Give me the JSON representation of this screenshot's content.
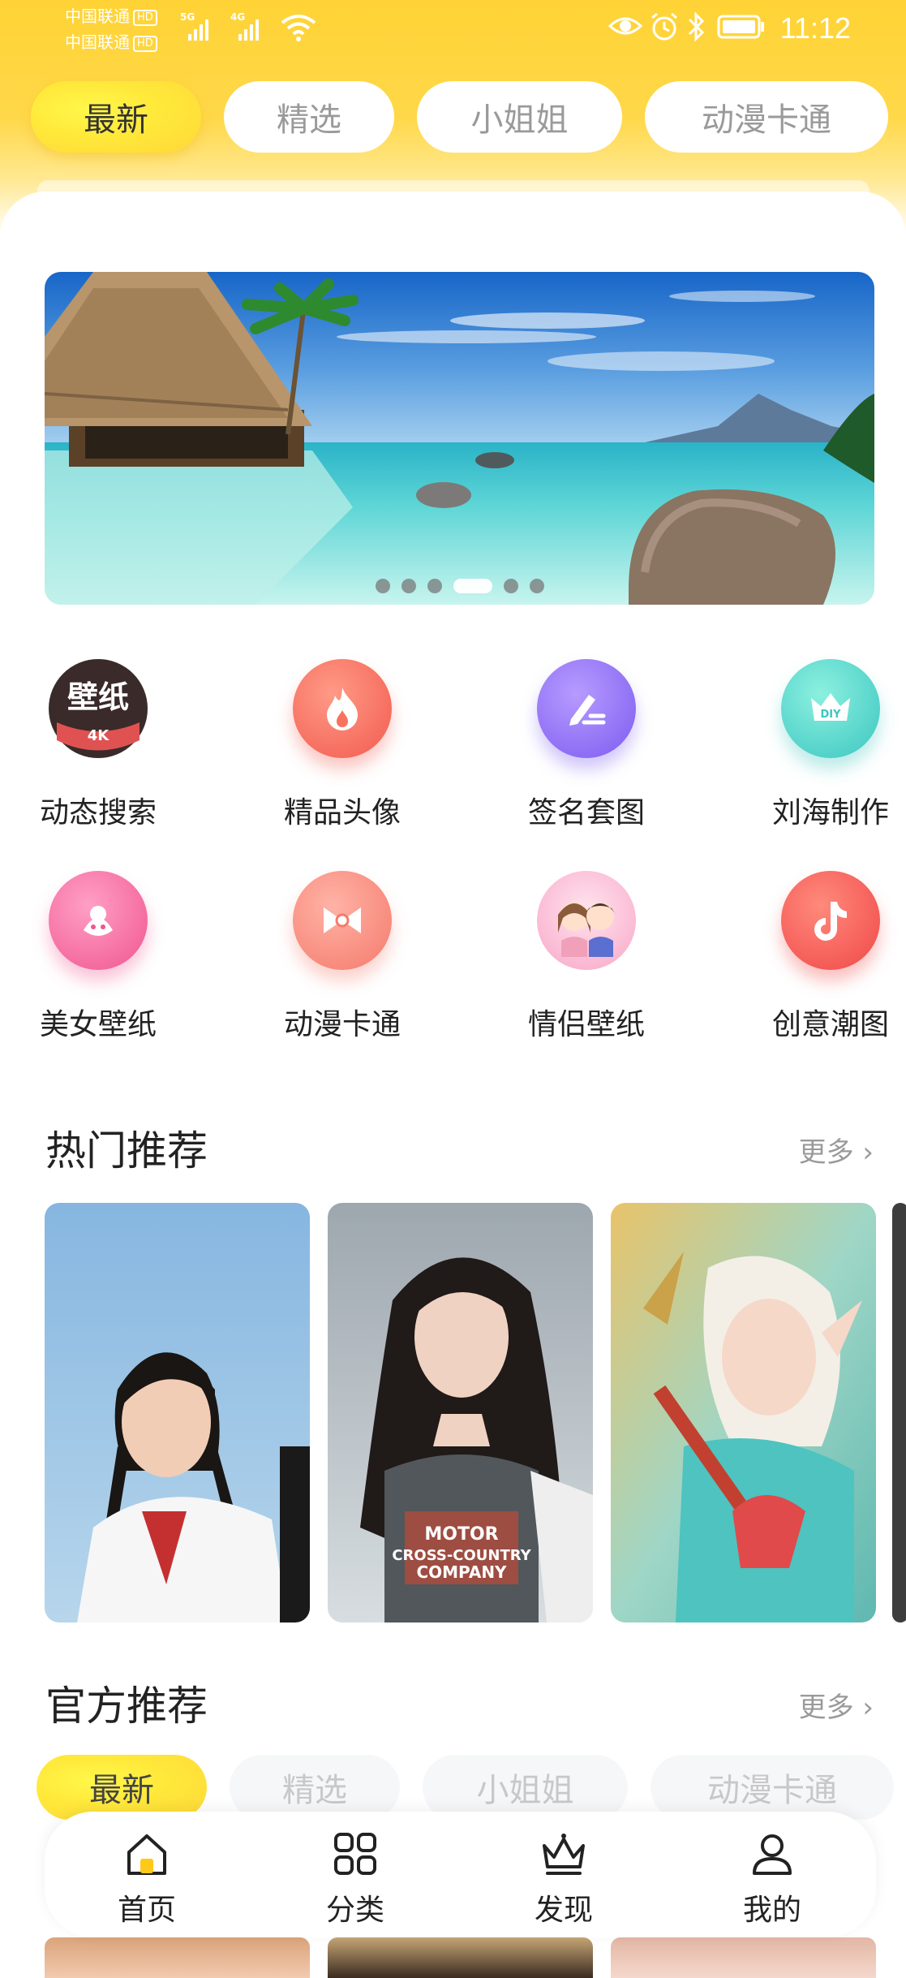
{
  "status_bar": {
    "carrier1": "中国联通",
    "carrier2": "中国联通",
    "hd": "HD",
    "net1": "5G",
    "net2": "4G",
    "time": "11:12"
  },
  "top_tabs": [
    {
      "label": "最新",
      "active": true
    },
    {
      "label": "精选",
      "active": false
    },
    {
      "label": "小姐姐",
      "active": false
    },
    {
      "label": "动漫卡通",
      "active": false
    }
  ],
  "banner": {
    "dot_count": 6,
    "active_index": 3
  },
  "grid": [
    {
      "label": "动态搜索",
      "icon": "wallpaper-4k-icon",
      "badge_text": "壁纸",
      "badge_sub": "4K"
    },
    {
      "label": "精品头像",
      "icon": "flame-icon"
    },
    {
      "label": "签名套图",
      "icon": "signature-pen-icon"
    },
    {
      "label": "刘海制作",
      "icon": "diy-crown-icon",
      "badge_text": "DIY"
    },
    {
      "label": "美女壁纸",
      "icon": "girl-face-icon"
    },
    {
      "label": "动漫卡通",
      "icon": "bow-icon"
    },
    {
      "label": "情侣壁纸",
      "icon": "couple-icon"
    },
    {
      "label": "创意潮图",
      "icon": "tiktok-note-icon"
    }
  ],
  "hot": {
    "title": "热门推荐",
    "more": "更多"
  },
  "official": {
    "title": "官方推荐",
    "more": "更多"
  },
  "sub_tabs": [
    {
      "label": "最新",
      "active": true
    },
    {
      "label": "精选",
      "active": false
    },
    {
      "label": "小姐姐",
      "active": false
    },
    {
      "label": "动漫卡通",
      "active": false
    }
  ],
  "card_shirt_text": [
    "MOTOR",
    "CROSS-COUNTRY",
    "COMPANY"
  ],
  "bottom_nav": [
    {
      "label": "首页",
      "icon": "home-icon",
      "active": true
    },
    {
      "label": "分类",
      "icon": "category-grid-icon",
      "active": false
    },
    {
      "label": "发现",
      "icon": "crown-discover-icon",
      "active": false
    },
    {
      "label": "我的",
      "icon": "profile-icon",
      "active": false
    }
  ],
  "colors": {
    "accent_yellow": "#ffd838",
    "text_dark": "#222222",
    "text_gray": "#9a9a9a"
  }
}
